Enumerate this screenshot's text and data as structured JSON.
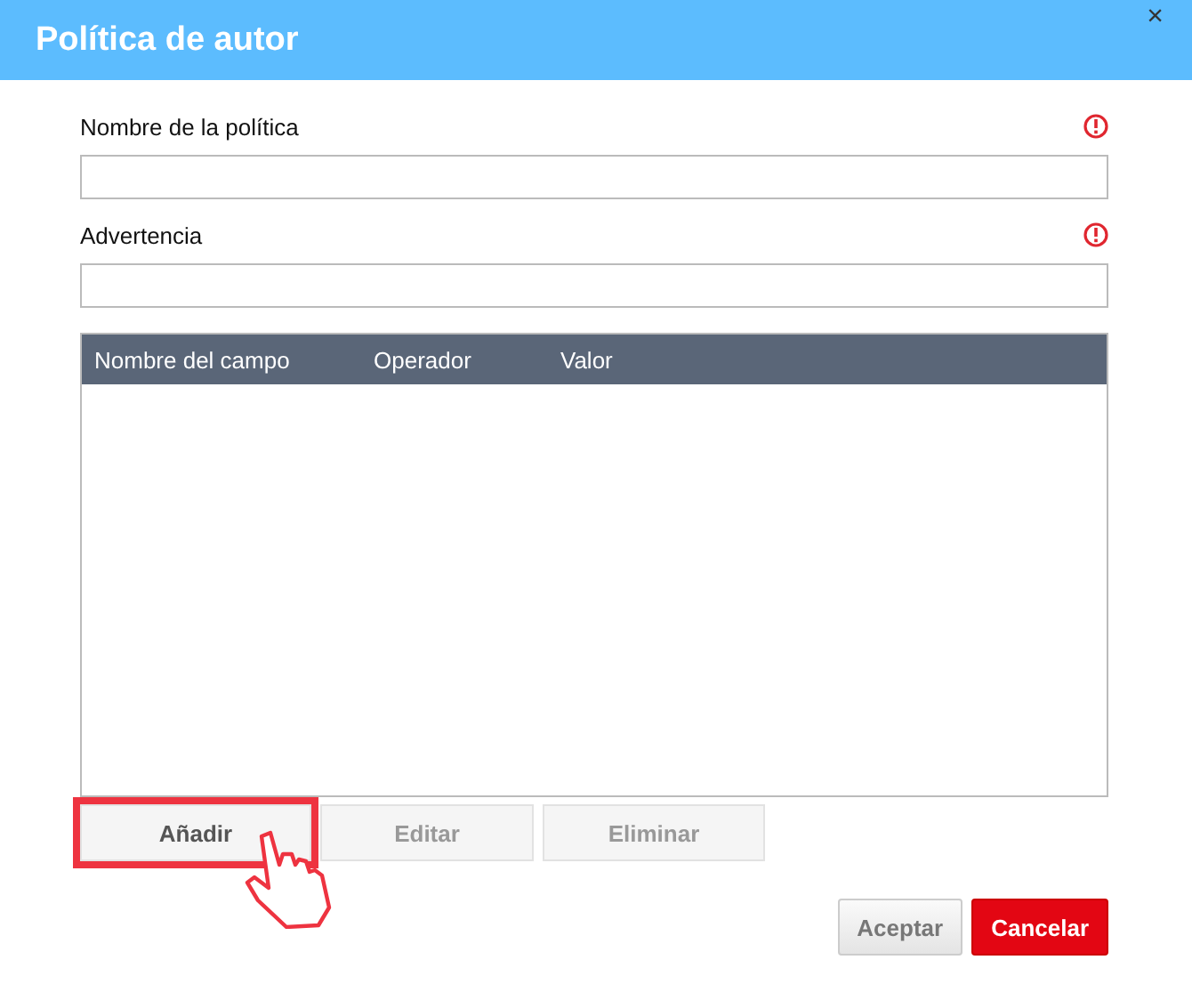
{
  "window": {
    "title": "Política de autor",
    "close": "×"
  },
  "fields": [
    {
      "label": "Nombre de la política",
      "required": true
    },
    {
      "label": "Advertencia",
      "required": true
    }
  ],
  "table": {
    "columns": [
      "Nombre del campo",
      "Operador",
      "Valor"
    ]
  },
  "row_buttons": [
    {
      "label": "Añadir",
      "disabled": false,
      "highlighted": true
    },
    {
      "label": "Editar",
      "disabled": true,
      "highlighted": false
    },
    {
      "label": "Eliminar",
      "disabled": true,
      "highlighted": false
    }
  ],
  "footer_buttons": [
    {
      "label": "Aceptar",
      "kind": "secondary"
    },
    {
      "label": "Cancelar",
      "kind": "primary"
    }
  ]
}
